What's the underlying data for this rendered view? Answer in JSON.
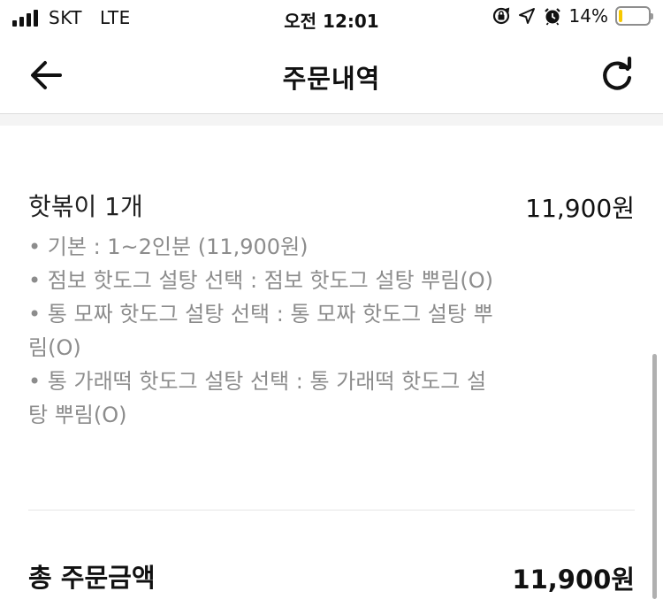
{
  "status_bar": {
    "carrier": "SKT",
    "network": "LTE",
    "time": "오전 12:01",
    "battery_percent": "14%",
    "battery_level": 0.14,
    "colors": {
      "battery": "#f7c800"
    }
  },
  "nav": {
    "title": "주문내역",
    "back_icon": "arrow-left-icon",
    "refresh_icon": "refresh-icon"
  },
  "order": {
    "item_name": "핫볶이 1개",
    "item_price": "11,900원",
    "options": [
      "• 기본 : 1~2인분 (11,900원)",
      "• 점보 핫도그 설탕 선택 : 점보 핫도그 설탕 뿌림(O)",
      "• 통 모짜 핫도그 설탕 선택 : 통 모짜 핫도그 설탕 뿌림(O)",
      "• 통 가래떡 핫도그 설탕 선택 : 통 가래떡 핫도그 설탕 뿌림(O)"
    ],
    "total_label": "총 주문금액",
    "total_price": "11,900원"
  }
}
